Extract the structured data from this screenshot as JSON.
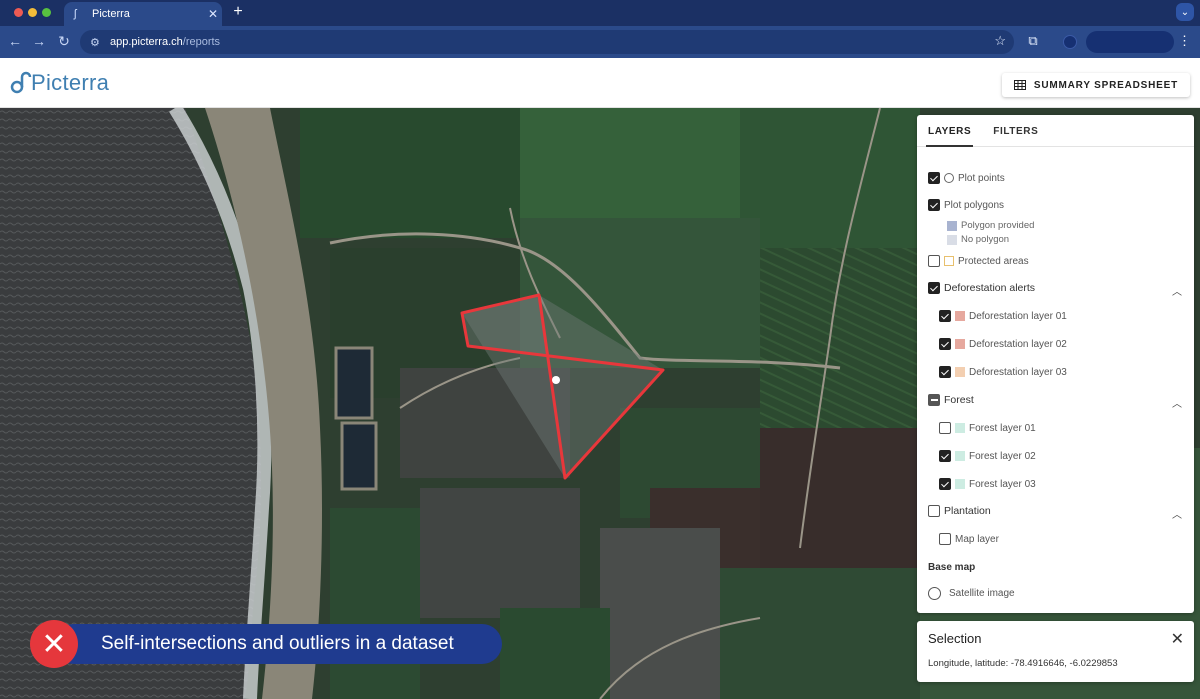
{
  "browser": {
    "tab_title": "Picterra",
    "url_host": "app.picterra.ch",
    "url_path": "/reports"
  },
  "app": {
    "logo_text": "Picterra",
    "summary_button": "SUMMARY SPREADSHEET"
  },
  "panel": {
    "tabs": [
      "LAYERS",
      "FILTERS"
    ],
    "active_tab": "LAYERS",
    "plot_points": "Plot points",
    "plot_polygons": "Plot polygons",
    "polygon_provided": "Polygon provided",
    "no_polygon": "No polygon",
    "protected_areas": "Protected areas",
    "deforestation_alerts": "Deforestation alerts",
    "deforestation_layers": [
      "Deforestation layer 01",
      "Deforestation layer 02",
      "Deforestation layer 03"
    ],
    "forest": "Forest",
    "forest_layers": [
      "Forest layer 01",
      "Forest layer 02",
      "Forest layer 03"
    ],
    "plantation": "Plantation",
    "map_layer": "Map layer",
    "base_map_title": "Base map",
    "satellite_image": "Satellite image"
  },
  "selection": {
    "title": "Selection",
    "coords": "Longitude, latitude: -78.4916646, -6.0229853"
  },
  "banner": {
    "text": "Self-intersections and outliers in a dataset"
  },
  "colors": {
    "polygon_outline": "#e8373b",
    "deforestation_swatch": "#e6a89e",
    "deforestation_swatch_3": "#f3cfb1",
    "forest_swatch": "#cdece2",
    "polygon_provided_swatch": "#a8b3d0",
    "no_polygon_swatch": "#d9dde6",
    "banner_bg": "#1f3b8f",
    "banner_icon": "#e5373c"
  }
}
